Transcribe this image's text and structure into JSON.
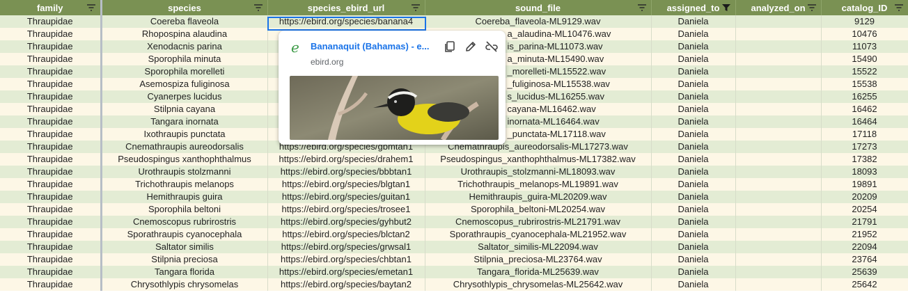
{
  "columns": [
    {
      "key": "family",
      "label": "family",
      "filter_active": false
    },
    {
      "key": "species",
      "label": "species",
      "filter_active": false
    },
    {
      "key": "url",
      "label": "species_ebird_url",
      "filter_active": false
    },
    {
      "key": "sound",
      "label": "sound_file",
      "filter_active": false
    },
    {
      "key": "assigned",
      "label": "assigned_to",
      "filter_active": true
    },
    {
      "key": "analyzed",
      "label": "analyzed_on",
      "filter_active": false
    },
    {
      "key": "catalog",
      "label": "catalog_ID",
      "filter_active": false
    }
  ],
  "rows": [
    [
      "Thraupidae",
      "Coereba flaveola",
      "https://ebird.org/species/banana4",
      "Coereba_flaveola-ML9129.wav",
      "Daniela",
      "",
      "9129"
    ],
    [
      "Thraupidae",
      "Rhopospina alaudina",
      "",
      "a_alaudina-ML10476.wav",
      "Daniela",
      "",
      "10476"
    ],
    [
      "Thraupidae",
      "Xenodacnis parina",
      "",
      "is_parina-ML11073.wav",
      "Daniela",
      "",
      "11073"
    ],
    [
      "Thraupidae",
      "Sporophila minuta",
      "",
      "a_minuta-ML15490.wav",
      "Daniela",
      "",
      "15490"
    ],
    [
      "Thraupidae",
      "Sporophila morelleti",
      "",
      "_morelleti-ML15522.wav",
      "Daniela",
      "",
      "15522"
    ],
    [
      "Thraupidae",
      "Asemospiza fuliginosa",
      "",
      "_fuliginosa-ML15538.wav",
      "Daniela",
      "",
      "15538"
    ],
    [
      "Thraupidae",
      "Cyanerpes lucidus",
      "",
      "s_lucidus-ML16255.wav",
      "Daniela",
      "",
      "16255"
    ],
    [
      "Thraupidae",
      "Stilpnia cayana",
      "",
      "cayana-ML16462.wav",
      "Daniela",
      "",
      "16462"
    ],
    [
      "Thraupidae",
      "Tangara inornata",
      "",
      "inornata-ML16464.wav",
      "Daniela",
      "",
      "16464"
    ],
    [
      "Thraupidae",
      "Ixothraupis punctata",
      "",
      "_punctata-ML17118.wav",
      "Daniela",
      "",
      "17118"
    ],
    [
      "Thraupidae",
      "Cnemathraupis aureodorsalis",
      "https://ebird.org/species/gbmtan1",
      "Cnemathraupis_aureodorsalis-ML17273.wav",
      "Daniela",
      "",
      "17273"
    ],
    [
      "Thraupidae",
      "Pseudospingus xanthophthalmus",
      "https://ebird.org/species/drahem1",
      "Pseudospingus_xanthophthalmus-ML17382.wav",
      "Daniela",
      "",
      "17382"
    ],
    [
      "Thraupidae",
      "Urothraupis stolzmanni",
      "https://ebird.org/species/bbbtan1",
      "Urothraupis_stolzmanni-ML18093.wav",
      "Daniela",
      "",
      "18093"
    ],
    [
      "Thraupidae",
      "Trichothraupis melanops",
      "https://ebird.org/species/blgtan1",
      "Trichothraupis_melanops-ML19891.wav",
      "Daniela",
      "",
      "19891"
    ],
    [
      "Thraupidae",
      "Hemithraupis guira",
      "https://ebird.org/species/guitan1",
      "Hemithraupis_guira-ML20209.wav",
      "Daniela",
      "",
      "20209"
    ],
    [
      "Thraupidae",
      "Sporophila beltoni",
      "https://ebird.org/species/trosee1",
      "Sporophila_beltoni-ML20254.wav",
      "Daniela",
      "",
      "20254"
    ],
    [
      "Thraupidae",
      "Cnemoscopus rubrirostris",
      "https://ebird.org/species/gyhbut2",
      "Cnemoscopus_rubrirostris-ML21791.wav",
      "Daniela",
      "",
      "21791"
    ],
    [
      "Thraupidae",
      "Sporathraupis cyanocephala",
      "https://ebird.org/species/blctan2",
      "Sporathraupis_cyanocephala-ML21952.wav",
      "Daniela",
      "",
      "21952"
    ],
    [
      "Thraupidae",
      "Saltator similis",
      "https://ebird.org/species/grwsal1",
      "Saltator_similis-ML22094.wav",
      "Daniela",
      "",
      "22094"
    ],
    [
      "Thraupidae",
      "Stilpnia preciosa",
      "https://ebird.org/species/chbtan1",
      "Stilpnia_preciosa-ML23764.wav",
      "Daniela",
      "",
      "23764"
    ],
    [
      "Thraupidae",
      "Tangara florida",
      "https://ebird.org/species/emetan1",
      "Tangara_florida-ML25639.wav",
      "Daniela",
      "",
      "25639"
    ],
    [
      "Thraupidae",
      "Chrysothlypis chrysomelas",
      "https://ebird.org/species/baytan2",
      "Chrysothlypis_chrysomelas-ML25642.wav",
      "Daniela",
      "",
      "25642"
    ]
  ],
  "link_preview": {
    "title": "Bananaquit (Bahamas) - e...",
    "domain": "ebird.org",
    "site_icon": "ebird-e-icon",
    "actions": [
      "copy-icon",
      "edit-icon",
      "unlink-icon"
    ]
  },
  "colors": {
    "header_bg": "#7a9153",
    "row_green": "#e3ecd4",
    "row_cream": "#fdf7e6",
    "selection": "#1a73e8",
    "link": "#1a73e8"
  }
}
